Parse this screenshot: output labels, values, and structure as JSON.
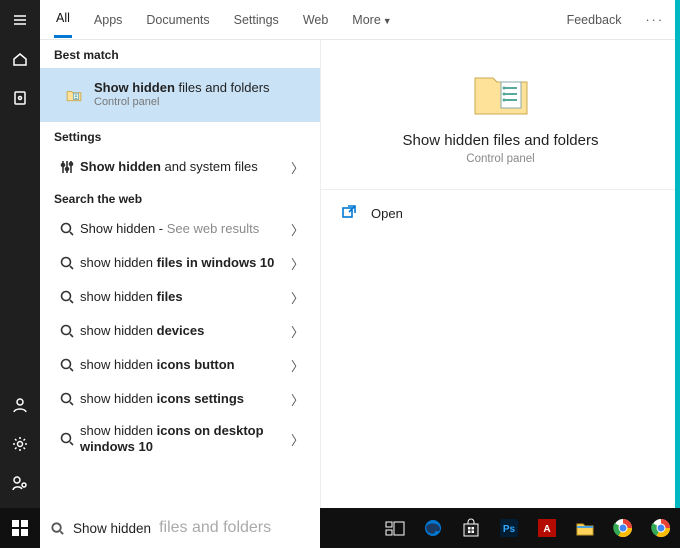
{
  "tabs": {
    "items": [
      "All",
      "Apps",
      "Documents",
      "Settings",
      "Web",
      "More"
    ],
    "feedback": "Feedback"
  },
  "sections": {
    "best": "Best match",
    "settings": "Settings",
    "web": "Search the web"
  },
  "best": {
    "title_bold": "Show hidden",
    "title_rest": " files and folders",
    "sub": "Control panel"
  },
  "settingsResults": [
    {
      "bold": "Show hidden",
      "rest": " and system files"
    }
  ],
  "webResults": [
    {
      "pre": "Show hidden",
      "bold": "",
      "suffix": " - ",
      "gray": "See web results"
    },
    {
      "pre": "show hidden ",
      "bold": "files in windows 10"
    },
    {
      "pre": "show hidden ",
      "bold": "files"
    },
    {
      "pre": "show hidden ",
      "bold": "devices"
    },
    {
      "pre": "show hidden ",
      "bold": "icons button"
    },
    {
      "pre": "show hidden ",
      "bold": "icons settings"
    },
    {
      "pre": "show hidden ",
      "bold": "icons on desktop windows 10"
    }
  ],
  "preview": {
    "title": "Show hidden files and folders",
    "sub": "Control panel",
    "open": "Open"
  },
  "search": {
    "typed": "Show hidden",
    "rest": " files and folders"
  }
}
